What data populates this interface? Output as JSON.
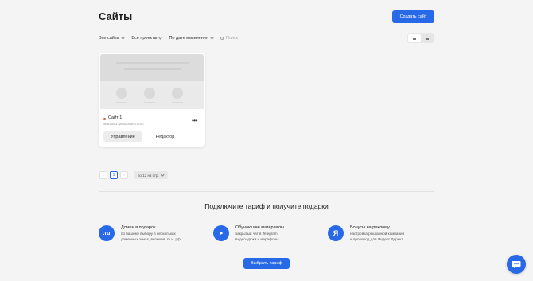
{
  "header": {
    "title": "Сайты",
    "create_button": "Создать сайт"
  },
  "filters": {
    "all_sites": "Все сайты",
    "all_projects": "Все проекты",
    "sort": "По дате изменения",
    "search_placeholder": "Поиск"
  },
  "site_card": {
    "name": "Сайт 1",
    "domain": "s663083.lpmotortest.com",
    "manage_button": "Управление",
    "editor_button": "Редактор",
    "status_color": "#e8503a"
  },
  "pagination": {
    "prev": "‹",
    "current_page": "1",
    "next": "›",
    "per_page": "по 12 на стр."
  },
  "promo": {
    "title": "Подключите тариф и получите подарки",
    "features": [
      {
        "icon": ".ru",
        "title": "Домен в подарок",
        "desc_lines": [
          "по вашему выбору в нескольких",
          "доменных зонах, включая .ru и .рф"
        ]
      },
      {
        "icon": "play-icon",
        "title": "Обучающие материалы",
        "desc_lines": [
          "закрытый чат в Telegram,",
          "видео-уроки и марафоны"
        ]
      },
      {
        "icon": "Я",
        "title": "Бонусы на рекламу",
        "desc_lines": [
          "настройка рекламной кампании",
          "и промокод для Яндекс.Директ"
        ]
      }
    ],
    "cta_button": "Выбрать тариф"
  },
  "colors": {
    "accent": "#2869e8",
    "background": "#f4f4f4"
  }
}
